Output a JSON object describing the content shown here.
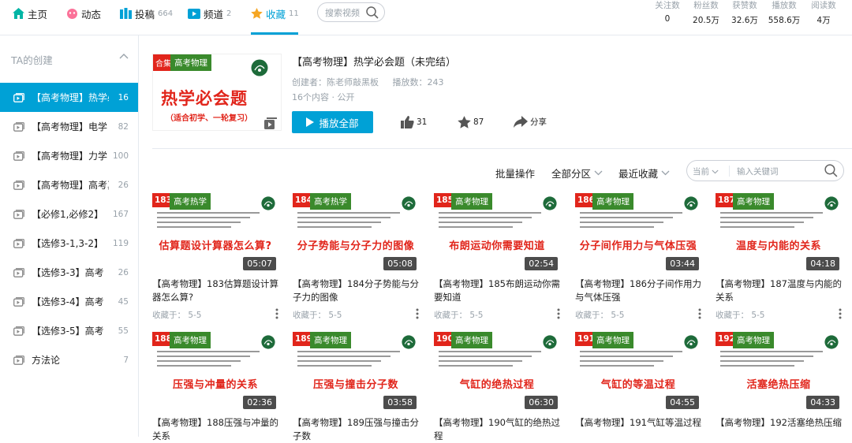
{
  "nav": [
    {
      "label": "主页",
      "count": "",
      "icon": "home-icon"
    },
    {
      "label": "动态",
      "count": "",
      "icon": "activity-icon"
    },
    {
      "label": "投稿",
      "count": "664",
      "icon": "upload-icon"
    },
    {
      "label": "频道",
      "count": "2",
      "icon": "channel-icon"
    },
    {
      "label": "收藏",
      "count": "11",
      "icon": "star-icon"
    }
  ],
  "search": {
    "placeholder": "搜索视频"
  },
  "stats": [
    {
      "label": "关注数",
      "value": "0"
    },
    {
      "label": "粉丝数",
      "value": "20.5万"
    },
    {
      "label": "获赞数",
      "value": "32.6万"
    },
    {
      "label": "播放数",
      "value": "558.6万"
    },
    {
      "label": "阅读数",
      "value": "4万"
    }
  ],
  "sidebar": {
    "heading": "TA的创建",
    "items": [
      {
        "label": "【高考物理】热学必会题（未完结）",
        "count": "16"
      },
      {
        "label": "【高考物理】电学",
        "count": "82"
      },
      {
        "label": "【高考物理】力学",
        "count": "100"
      },
      {
        "label": "【高考物理】高考真题",
        "count": "26"
      },
      {
        "label": "【必修1,必修2】",
        "count": "167"
      },
      {
        "label": "【选修3-1,3-2】",
        "count": "119"
      },
      {
        "label": "【选修3-3】高考",
        "count": "26"
      },
      {
        "label": "【选修3-4】高考",
        "count": "45"
      },
      {
        "label": "【选修3-5】高考",
        "count": "55"
      },
      {
        "label": "方法论",
        "count": "7"
      }
    ]
  },
  "collection": {
    "cover_tag": "合集",
    "cover_section": "高考物理",
    "cover_title": "热学必会题",
    "cover_sub": "（适合初学、一轮复习）",
    "title": "【高考物理】热学必会题（未完结）",
    "creator": "创建者：陈老师敲黑板",
    "plays": "播放数：243",
    "contents": "16个内容 · 公开",
    "play_all": "播放全部",
    "likes": "31",
    "favorites": "87",
    "share": "分享"
  },
  "filters": {
    "batch": "批量操作",
    "all": "全部分区",
    "sort": "最近收藏"
  },
  "video_search": {
    "scope": "当前",
    "placeholder": "输入关键词"
  },
  "videos": [
    {
      "ep": "183",
      "section": "高考热学",
      "heading": "估算题设计算器怎么算?",
      "duration": "05:07",
      "title": "【高考物理】183估算题设计算器怎么算?",
      "fav": "收藏于：  5-5"
    },
    {
      "ep": "184",
      "section": "高考热学",
      "heading": "分子势能与分子力的图像",
      "duration": "05:08",
      "title": "【高考物理】184分子势能与分子力的图像",
      "fav": "收藏于：  5-5"
    },
    {
      "ep": "185",
      "section": "高考物理",
      "heading": "布朗运动你需要知道",
      "duration": "02:54",
      "title": "【高考物理】185布朗运动你需要知道",
      "fav": "收藏于：  5-5"
    },
    {
      "ep": "186",
      "section": "高考物理",
      "heading": "分子间作用力与气体压强",
      "duration": "03:44",
      "title": "【高考物理】186分子间作用力与气体压强",
      "fav": "收藏于：  5-5"
    },
    {
      "ep": "187",
      "section": "高考物理",
      "heading": "温度与内能的关系",
      "duration": "04:18",
      "title": "【高考物理】187温度与内能的关系",
      "fav": "收藏于：  5-5"
    },
    {
      "ep": "188",
      "section": "高考物理",
      "heading": "压强与冲量的关系",
      "duration": "02:36",
      "title": "【高考物理】188压强与冲量的关系",
      "fav": ""
    },
    {
      "ep": "189",
      "section": "高考物理",
      "heading": "压强与撞击分子数",
      "duration": "03:58",
      "title": "【高考物理】189压强与撞击分子数",
      "fav": ""
    },
    {
      "ep": "190",
      "section": "高考物理",
      "heading": "气缸的绝热过程",
      "duration": "06:30",
      "title": "【高考物理】190气缸的绝热过程",
      "fav": ""
    },
    {
      "ep": "191",
      "section": "高考物理",
      "heading": "气缸的等温过程",
      "duration": "04:55",
      "title": "【高考物理】191气缸等温过程",
      "fav": ""
    },
    {
      "ep": "192",
      "section": "高考物理",
      "heading": "活塞绝热压缩",
      "duration": "04:33",
      "title": "【高考物理】192活塞绝热压缩",
      "fav": ""
    }
  ],
  "colors": {
    "accent": "#00a1d6",
    "red": "#e1251b",
    "green": "#3a8a2c"
  }
}
